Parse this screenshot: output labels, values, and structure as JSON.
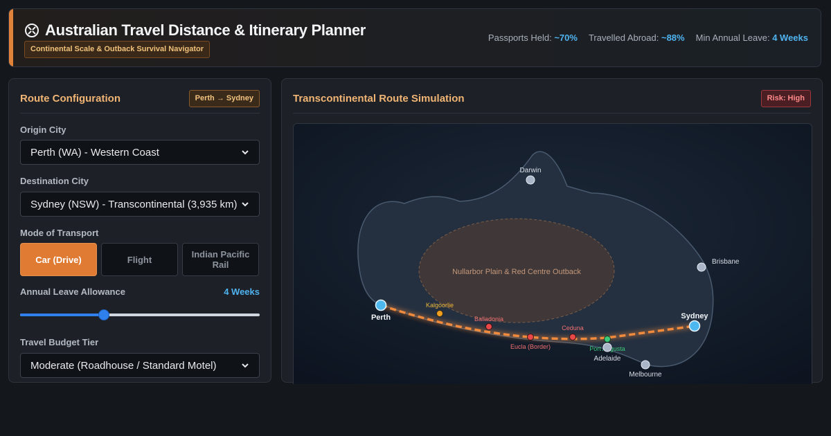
{
  "header": {
    "title": "Australian Travel Distance & Itinerary Planner",
    "subtitle": "Continental Scale & Outback Survival Navigator",
    "icon": "compass-icon",
    "accent_color": "#e0823a",
    "stats": [
      {
        "label": "Passports Held:",
        "value": "~70%"
      },
      {
        "label": "Travelled Abroad:",
        "value": "~88%"
      },
      {
        "label": "Min Annual Leave:",
        "value": "4 Weeks"
      }
    ]
  },
  "config": {
    "title": "Route Configuration",
    "route_badge": "Perth → Sydney",
    "origin_label": "Origin City",
    "origin_value": "Perth (WA) - Western Coast",
    "destination_label": "Destination City",
    "destination_value": "Sydney (NSW) - Transcontinental (3,935 km)",
    "transport_label": "Mode of Transport",
    "transport_options": [
      "Car (Drive)",
      "Flight",
      "Indian Pacific Rail"
    ],
    "transport_selected": "Car (Drive)",
    "leave_label": "Annual Leave Allowance",
    "leave_value": "4 Weeks",
    "leave_slider_fraction": 0.35,
    "budget_label": "Travel Budget Tier",
    "budget_value": "Moderate (Roadhouse / Standard Motel)"
  },
  "simulation": {
    "title": "Transcontinental Route Simulation",
    "risk_badge": "Risk: High",
    "region_label": "Nullarbor Plain & Red Centre Outback",
    "cities": {
      "darwin": "Darwin",
      "brisbane": "Brisbane",
      "perth": "Perth",
      "sydney": "Sydney",
      "adelaide": "Adelaide",
      "melbourne": "Melbourne"
    },
    "stops": {
      "kalgoorlie": "Kalgoorlie",
      "balladonia": "Balladonia",
      "eucla": "Eucla (Border)",
      "ceduna": "Ceduna",
      "port_augusta": "Port Augusta"
    },
    "colors": {
      "route": "#f08a3c",
      "endpoint": "#4db8f0",
      "hazard": "#e84848",
      "fuel": "#f0a020",
      "safe": "#3cc878"
    }
  }
}
